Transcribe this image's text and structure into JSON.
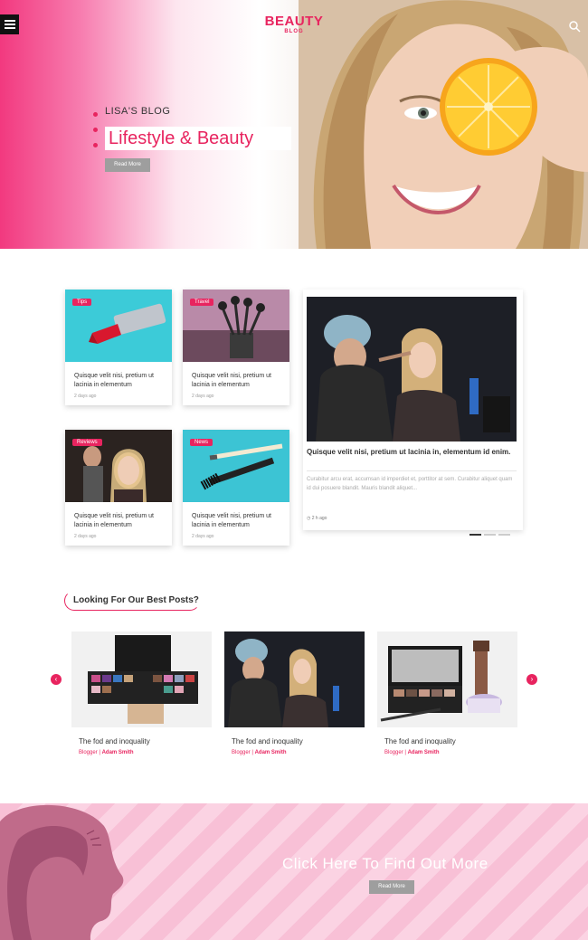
{
  "header": {
    "logo_main": "BEAUTY",
    "logo_sub": "BLOG",
    "menu_icon": "hamburger-icon",
    "search_icon": "search-icon"
  },
  "hero": {
    "subtitle": "LISA'S BLOG",
    "title": "Lifestyle & Beauty",
    "button_label": "Read More"
  },
  "cards": [
    {
      "tag": "Tips",
      "title": "Quisque velit nisi, pretium ut lacinia in elementum",
      "date": "2 days ago"
    },
    {
      "tag": "Travel",
      "title": "Quisque velit nisi, pretium ut lacinia in elementum",
      "date": "2 days ago"
    },
    {
      "tag": "Reviews",
      "title": "Quisque velit nisi, pretium ut lacinia in elementum",
      "date": "2 days ago"
    },
    {
      "tag": "News",
      "title": "Quisque velit nisi, pretium ut lacinia in elementum",
      "date": "2 days ago"
    }
  ],
  "feature": {
    "title": "Quisque velit nisi, pretium ut lacinia in, elementum id enim.",
    "text": "Curabitur arcu erat, accumsan id imperdiet et, porttitor at sem. Curabitur aliquet quam id dui posuere blandit. Mauris blandit aliquet...",
    "date": "2 h ago"
  },
  "best_posts": {
    "heading": "Looking For Our Best Posts?",
    "posts": [
      {
        "title": "The fod and inoquality",
        "author_prefix": "Blogger |",
        "author": "Adam Smith"
      },
      {
        "title": "The fod and inoquality",
        "author_prefix": "Blogger |",
        "author": "Adam Smith"
      },
      {
        "title": "The fod and inoquality",
        "author_prefix": "Blogger |",
        "author": "Adam Smith"
      }
    ],
    "prev_icon": "chevron-left-icon",
    "next_icon": "chevron-right-icon"
  },
  "banner": {
    "title": "Click Here To Find Out More",
    "button_label": "Read More"
  },
  "colors": {
    "accent": "#e8245f",
    "button_gray": "#9e9e9e"
  }
}
